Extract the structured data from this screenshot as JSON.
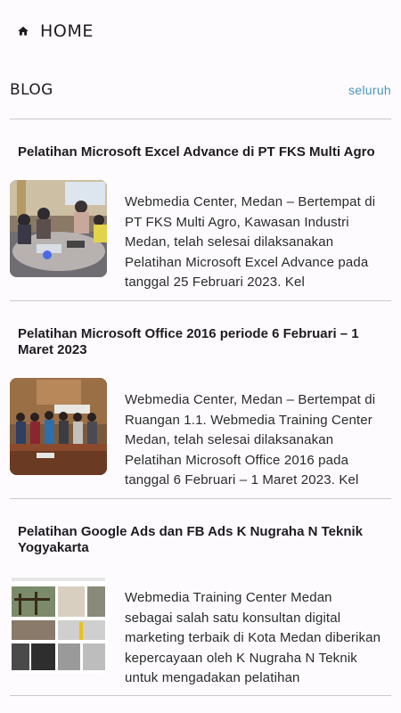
{
  "appbar": {
    "title": "HOME",
    "icon": "home-icon"
  },
  "section": {
    "title": "BLOG",
    "see_all_label": "seluruh",
    "accent": "#4a93bd"
  },
  "posts": [
    {
      "title": "Pelatihan Microsoft Excel Advance di PT FKS Multi Agro",
      "excerpt": "Webmedia Center, Medan – Bertempat di PT FKS Multi Agro, Kawasan Industri Medan, telah selesai dilaksanakan Pelatihan Microsoft Excel Advance pada tanggal 25 Februari 2023. Kel"
    },
    {
      "title": "Pelatihan Microsoft Office 2016 periode 6 Februari – 1 Maret 2023",
      "excerpt": "Webmedia Center, Medan – Bertempat di Ruangan 1.1. Webmedia Training Center Medan, telah selesai dilaksanakan Pelatihan Microsoft Office 2016 pada tanggal 6 Februari – 1 Maret 2023. Kel"
    },
    {
      "title": "Pelatihan Google Ads dan FB Ads K Nugraha N Teknik Yogyakarta",
      "excerpt": "Webmedia Training Center Medan sebagai salah satu konsultan digital marketing terbaik di Kota Medan diberikan kepercayaan oleh K Nugraha N Teknik untuk mengadakan pelatihan"
    }
  ]
}
